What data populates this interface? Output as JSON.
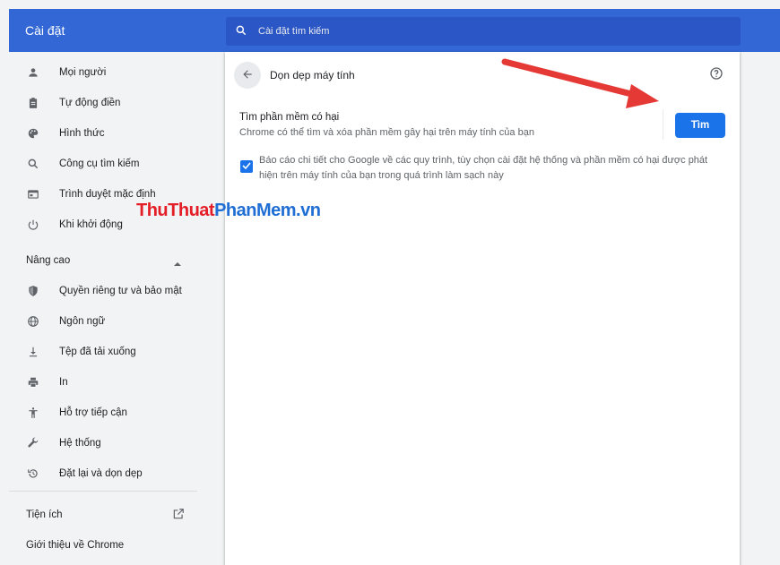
{
  "header": {
    "title": "Cài đặt",
    "search_placeholder": "Cài đặt tìm kiếm"
  },
  "sidebar": {
    "items": [
      {
        "label": "Mọi người",
        "icon": "person-icon"
      },
      {
        "label": "Tự động điền",
        "icon": "clipboard-icon"
      },
      {
        "label": "Hình thức",
        "icon": "palette-icon"
      },
      {
        "label": "Công cụ tìm kiếm",
        "icon": "search-icon"
      },
      {
        "label": "Trình duyệt mặc định",
        "icon": "browser-icon"
      },
      {
        "label": "Khi khởi động",
        "icon": "power-icon"
      }
    ],
    "advanced_label": "Nâng cao",
    "advanced_items": [
      {
        "label": "Quyền riêng tư và bảo mật",
        "icon": "shield-icon"
      },
      {
        "label": "Ngôn ngữ",
        "icon": "globe-icon"
      },
      {
        "label": "Tệp đã tải xuống",
        "icon": "download-icon"
      },
      {
        "label": "In",
        "icon": "printer-icon"
      },
      {
        "label": "Hỗ trợ tiếp cận",
        "icon": "accessibility-icon"
      },
      {
        "label": "Hệ thống",
        "icon": "wrench-icon"
      },
      {
        "label": "Đặt lại và dọn dẹp",
        "icon": "restore-icon"
      }
    ],
    "extensions_label": "Tiện ích",
    "about_label": "Giới thiệu về Chrome"
  },
  "main": {
    "page_title": "Dọn dẹp máy tính",
    "find_title": "Tìm phần mềm có hại",
    "find_description": "Chrome có thể tìm và xóa phần mềm gây hại trên máy tính của bạn",
    "find_button": "Tìm",
    "report_checked": true,
    "report_text": "Báo cáo chi tiết cho Google về các quy trình, tùy chọn cài đặt hệ thống và phần mềm có hại được phát hiện trên máy tính của bạn trong quá trình làm sạch này"
  },
  "watermark": {
    "part1": "ThuThuat",
    "part2": "PhanMem.vn"
  },
  "colors": {
    "header_bg": "#3367d6",
    "accent": "#1a73e8",
    "arrow": "#e53935"
  }
}
